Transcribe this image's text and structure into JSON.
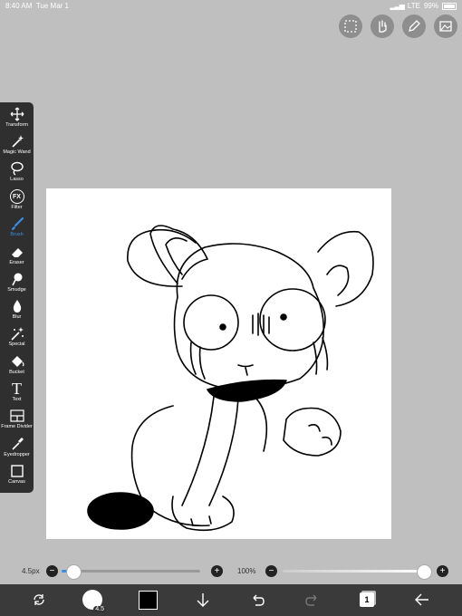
{
  "status_bar": {
    "time": "8:40 AM",
    "date": "Tue Mar 1",
    "network": "LTE",
    "battery": "99%"
  },
  "top_buttons": [
    "selection-icon",
    "hand-icon",
    "pen-icon",
    "gallery-icon"
  ],
  "tools": [
    {
      "label": "Transform",
      "icon": "move-arrows-icon"
    },
    {
      "label": "Magic Wand",
      "icon": "magic-wand-icon"
    },
    {
      "label": "Lasso",
      "icon": "lasso-icon"
    },
    {
      "label": "Filter",
      "icon": "fx-icon",
      "glyph": "FX"
    },
    {
      "label": "Brush",
      "icon": "brush-icon",
      "active": true
    },
    {
      "label": "Eraser",
      "icon": "eraser-icon"
    },
    {
      "label": "Smudge",
      "icon": "smudge-icon"
    },
    {
      "label": "Blur",
      "icon": "blur-drop-icon"
    },
    {
      "label": "Special",
      "icon": "special-wand-icon"
    },
    {
      "label": "Bucket",
      "icon": "bucket-icon"
    },
    {
      "label": "Text",
      "icon": "text-icon",
      "glyph": "T"
    },
    {
      "label": "Frame Divider",
      "icon": "frame-divider-icon"
    },
    {
      "label": "Eyedropper",
      "icon": "eyedropper-icon"
    },
    {
      "label": "Canvas",
      "icon": "canvas-icon"
    }
  ],
  "brush_size": {
    "value_label": "4.5px",
    "minus": "−",
    "plus": "+",
    "level": 0.08
  },
  "opacity": {
    "value_label": "100%",
    "minus": "−",
    "plus": "+",
    "level": 1.0
  },
  "bottom_bar": {
    "brush_size_badge": "4.5",
    "layer_count": "1",
    "color": "#000000"
  },
  "colors": {
    "accent": "#3a8ee6",
    "toolbar_bg": "#2f2f2f",
    "app_bg": "#bfbfbf"
  }
}
